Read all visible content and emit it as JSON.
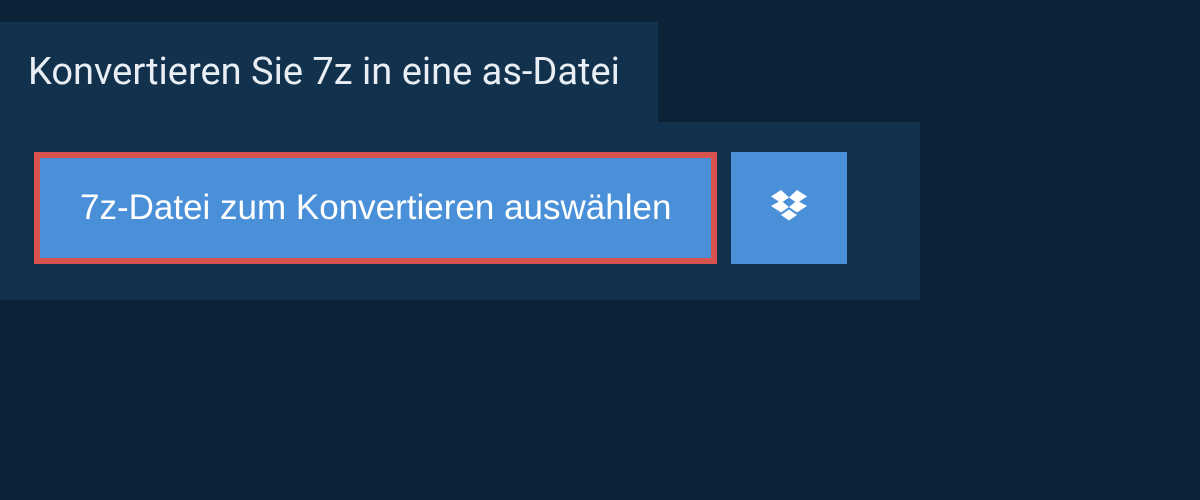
{
  "header": {
    "title": "Konvertieren Sie 7z in eine as-Datei"
  },
  "upload": {
    "select_label": "7z-Datei zum Konvertieren auswählen"
  }
}
